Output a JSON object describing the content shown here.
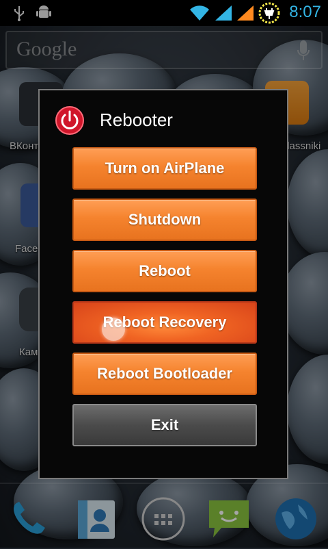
{
  "status_bar": {
    "time": "8:07",
    "icons": [
      "usb-icon",
      "android-debug-icon",
      "wifi-icon",
      "signal-icon",
      "signal-icon",
      "battery-charging-icon"
    ],
    "accent_color": "#33b5e5"
  },
  "search": {
    "logo_text": "Google",
    "mic_icon": "mic-icon"
  },
  "home_apps": [
    {
      "label": "ВКонтакте"
    },
    {
      "label": "Odnoklassniki"
    },
    {
      "label": "Facebook"
    },
    {
      "label": "Камера"
    }
  ],
  "dialog": {
    "title": "Rebooter",
    "icon": "power-icon",
    "buttons": [
      {
        "label": "Turn on AirPlane"
      },
      {
        "label": "Shutdown"
      },
      {
        "label": "Reboot"
      },
      {
        "label": "Reboot Recovery"
      },
      {
        "label": "Reboot Bootloader"
      },
      {
        "label": "Exit"
      }
    ],
    "colors": {
      "button": "#f5832e",
      "exit_button": "#4b4b4b"
    }
  },
  "dock": {
    "items": [
      "phone-icon",
      "contacts-icon",
      "app-drawer-icon",
      "messaging-icon",
      "browser-icon"
    ]
  }
}
